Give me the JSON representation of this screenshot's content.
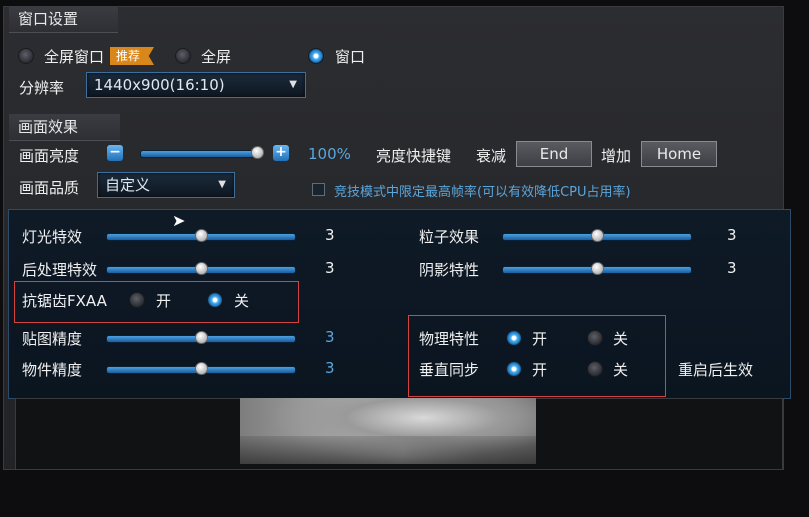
{
  "window_section": {
    "title": "窗口设置",
    "modes": [
      {
        "label": "全屏窗口",
        "badge": "推荐",
        "selected": false
      },
      {
        "label": "全屏",
        "selected": false
      },
      {
        "label": "窗口",
        "selected": true
      }
    ],
    "resolution_label": "分辨率",
    "resolution_value": "1440x900(16:10)"
  },
  "effects_section": {
    "title": "画面效果",
    "brightness_label": "画面亮度",
    "brightness_value": "100%",
    "brightness_level": 1.0,
    "hotkey_label": "亮度快捷键",
    "decrease_label": "衰减",
    "decrease_key": "End",
    "increase_label": "增加",
    "increase_key": "Home",
    "quality_label": "画面品质",
    "quality_value": "自定义",
    "limit_fps_label": "竞技模式中限定最高帧率(可以有效降低CPU占用率)",
    "limit_fps_checked": false
  },
  "custom_settings": {
    "lighting": {
      "label": "灯光特效",
      "value": "3"
    },
    "post_processing": {
      "label": "后处理特效",
      "value": "3"
    },
    "particles": {
      "label": "粒子效果",
      "value": "3"
    },
    "shadows": {
      "label": "阴影特性",
      "value": "3"
    },
    "fxaa": {
      "label": "抗锯齿FXAA",
      "on_label": "开",
      "off_label": "关",
      "selected": "off"
    },
    "texture": {
      "label": "贴图精度",
      "value": "3"
    },
    "objects": {
      "label": "物件精度",
      "value": "3"
    },
    "physics": {
      "label": "物理特性",
      "on_label": "开",
      "off_label": "关",
      "selected": "on"
    },
    "vsync": {
      "label": "垂直同步",
      "on_label": "开",
      "off_label": "关",
      "selected": "on"
    },
    "restart_note": "重启后生效"
  },
  "colors": {
    "accent": "#4a9fe0",
    "badge": "#d9861b",
    "highlight_box": "#d4433f"
  },
  "icons": {
    "minus": "minus-icon",
    "plus": "plus-icon",
    "dropdown": "chevron-down-icon",
    "cursor": "mouse-cursor-icon"
  }
}
